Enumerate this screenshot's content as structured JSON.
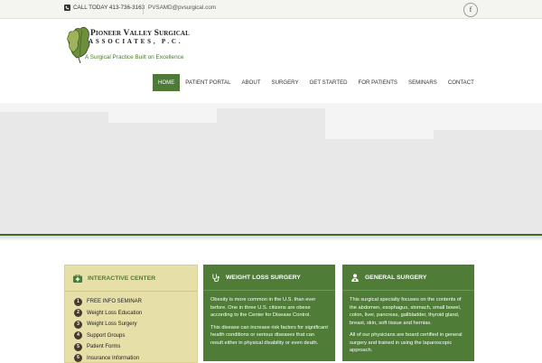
{
  "topbar": {
    "phone": "CALL TODAY 413-736-3163",
    "email": "PVSAMD@pvsurgical.com",
    "social_icon": "facebook-icon"
  },
  "brand": {
    "line1": "Pioneer Valley Surgical",
    "line2": "ASSOCIATES, P.C.",
    "tagline": "A Surgical Practice Built on Excellence",
    "colors": {
      "green": "#4d7b35",
      "dark_green": "#3f6b2a",
      "cream": "#e6dfa8"
    }
  },
  "nav": {
    "items": [
      {
        "label": "HOME",
        "active": true
      },
      {
        "label": "PATIENT PORTAL"
      },
      {
        "label": "ABOUT"
      },
      {
        "label": "SURGERY"
      },
      {
        "label": "GET STARTED"
      },
      {
        "label": "FOR PATIENTS"
      },
      {
        "label": "SEMINARS"
      },
      {
        "label": "CONTACT"
      }
    ]
  },
  "interactive": {
    "title": "INTERACTIVE CENTER",
    "icon": "first-aid-icon",
    "items": [
      {
        "num": "1",
        "label": "FREE INFO SEMINAR"
      },
      {
        "num": "2",
        "label": "Weight Loss Education"
      },
      {
        "num": "3",
        "label": "Weight Loss Surgery"
      },
      {
        "num": "4",
        "label": "Support Groups"
      },
      {
        "num": "5",
        "label": "Patient Forms"
      },
      {
        "num": "6",
        "label": "Insurance Information"
      }
    ]
  },
  "weight_loss": {
    "title": "WEIGHT LOSS SURGERY",
    "icon": "stethoscope-icon",
    "p1": "Obesity is more common in the U.S. than ever before. One in three U.S. citizens are obese according to the Center for Disease Control.",
    "p2": "This disease can increase risk factors for significant health conditions or serious diseases that can result either in physical disability or even death."
  },
  "general": {
    "title": "GENERAL SURGERY",
    "icon": "doctor-icon",
    "p1": "This surgical specialty focuses on the contents of the abdomen, esophagus, stomach, small bowel, colon, liver, pancreas, gallbladder, thyroid gland, breast, skin, soft tissue and hernias.",
    "p2": "All of our physicians are board certified in general surgery and trained in using the laparoscopic approach."
  }
}
